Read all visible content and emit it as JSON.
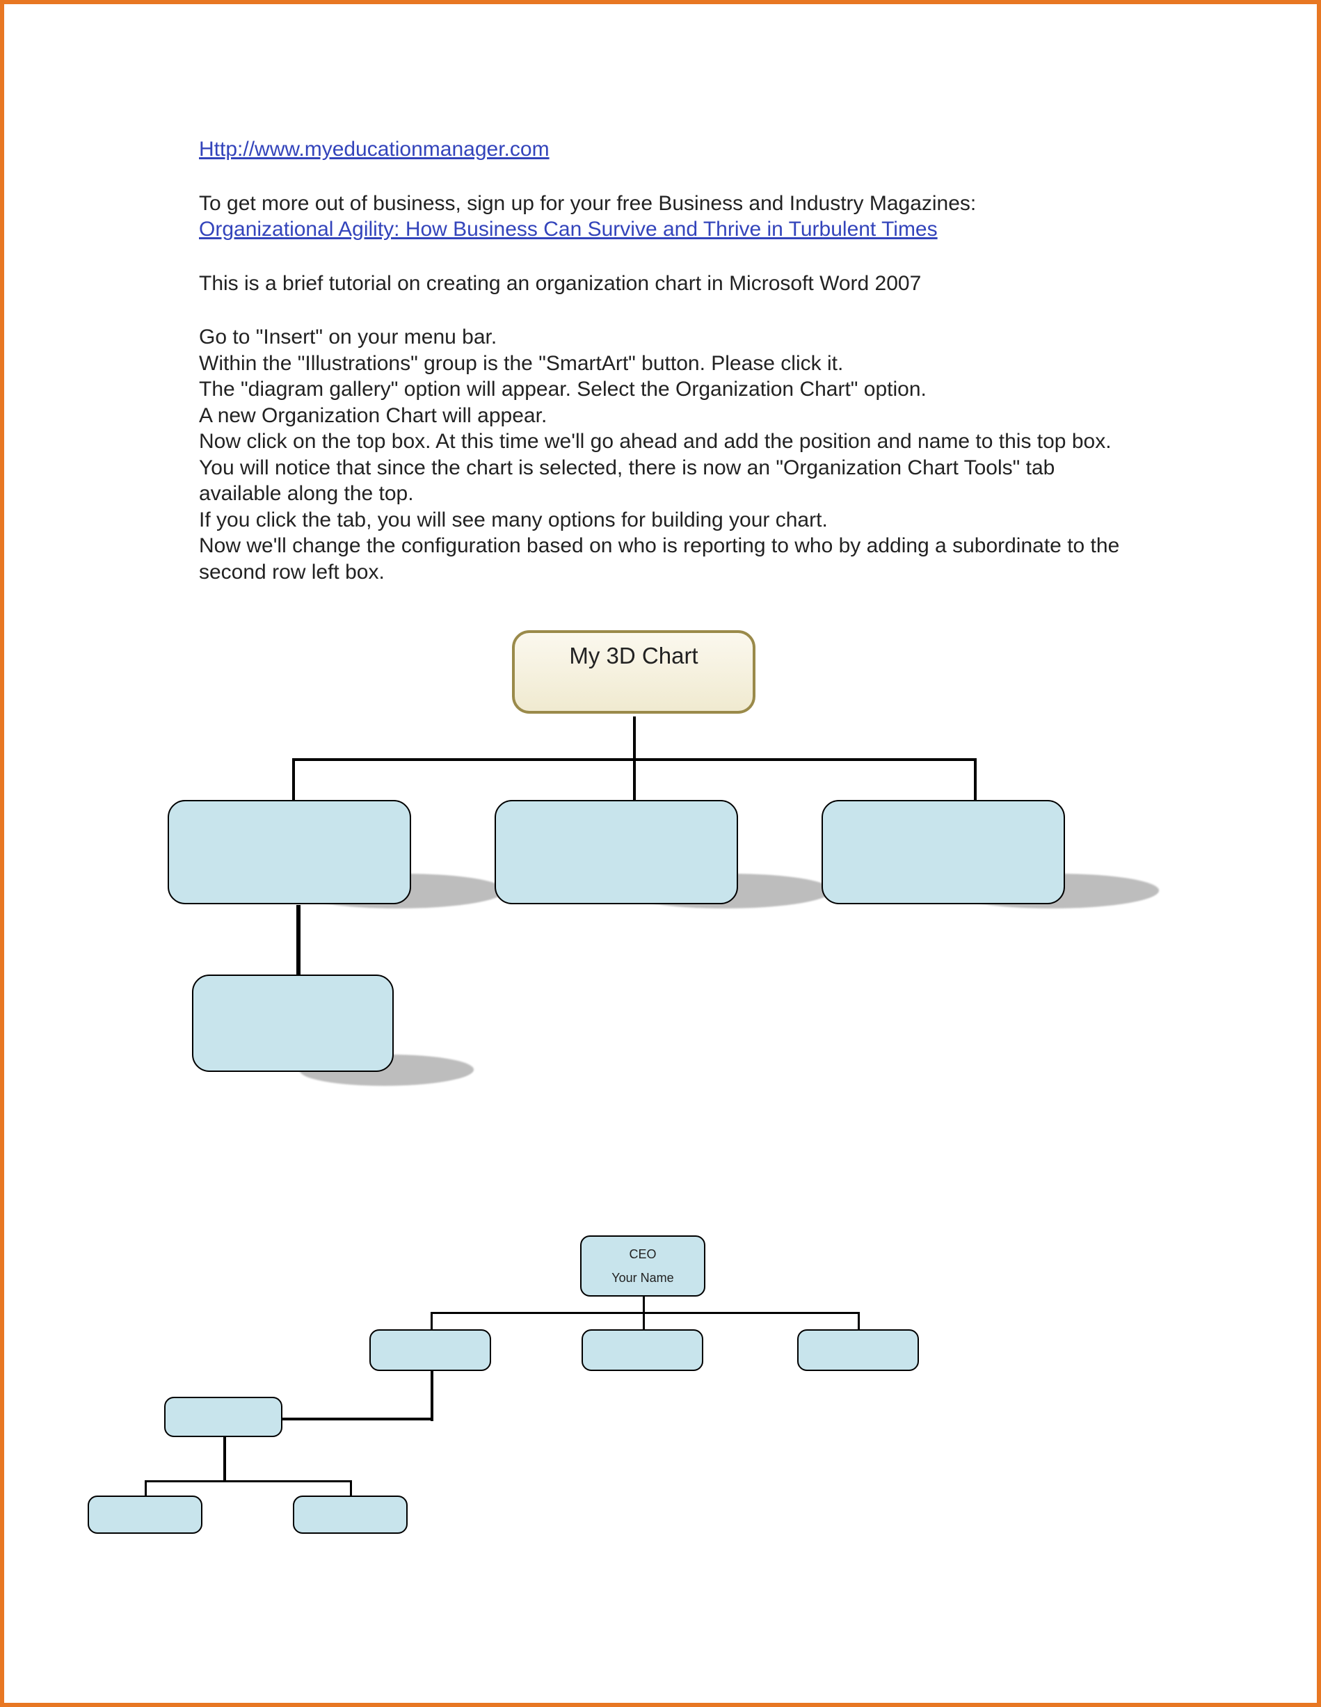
{
  "header": {
    "site_url": "Http://www.myeducationmanager.com",
    "signup_text": "To get more out of business, sign up for your free Business and Industry Magazines:",
    "article_link": "Organizational Agility: How Business Can Survive and Thrive in Turbulent Times"
  },
  "intro": "This is a brief tutorial on creating an organization chart in Microsoft Word 2007",
  "steps": [
    "Go to \"Insert\" on your menu bar.",
    "Within the \"Illustrations\" group is the \"SmartArt\" button. Please click it.",
    "The \"diagram gallery\" option will appear. Select the Organization Chart\" option.",
    "A new Organization Chart will appear.",
    "Now click on the top box. At this time we'll go ahead and add the position and name to this top box.",
    "You will notice that since the chart is selected, there is now an \"Organization Chart Tools\" tab available along the top.",
    "If you click the tab, you will see many options for building your chart.",
    "Now we'll change the configuration based on who is reporting to who by adding a subordinate to the second row left box."
  ],
  "chart1": {
    "root": "My 3D Chart",
    "children": [
      "",
      "",
      ""
    ],
    "grandchild": ""
  },
  "chart2": {
    "root_title": "CEO",
    "root_name": "Your Name",
    "level2": [
      "",
      "",
      ""
    ],
    "level3_left": "",
    "level4": [
      "",
      ""
    ]
  },
  "chart_data": [
    {
      "type": "org-chart",
      "title": "My 3D Chart",
      "nodes": [
        {
          "id": "root",
          "label": "My 3D Chart",
          "parent": null
        },
        {
          "id": "c1",
          "label": "",
          "parent": "root"
        },
        {
          "id": "c2",
          "label": "",
          "parent": "root"
        },
        {
          "id": "c3",
          "label": "",
          "parent": "root"
        },
        {
          "id": "g1",
          "label": "",
          "parent": "c1"
        }
      ]
    },
    {
      "type": "org-chart",
      "title": "CEO",
      "nodes": [
        {
          "id": "ceo",
          "label": "CEO",
          "subtitle": "Your Name",
          "parent": null
        },
        {
          "id": "l2a",
          "label": "",
          "parent": "ceo"
        },
        {
          "id": "l2b",
          "label": "",
          "parent": "ceo"
        },
        {
          "id": "l2c",
          "label": "",
          "parent": "ceo"
        },
        {
          "id": "l3a",
          "label": "",
          "parent": "l2a"
        },
        {
          "id": "l4a",
          "label": "",
          "parent": "l3a"
        },
        {
          "id": "l4b",
          "label": "",
          "parent": "l3a"
        }
      ]
    }
  ]
}
